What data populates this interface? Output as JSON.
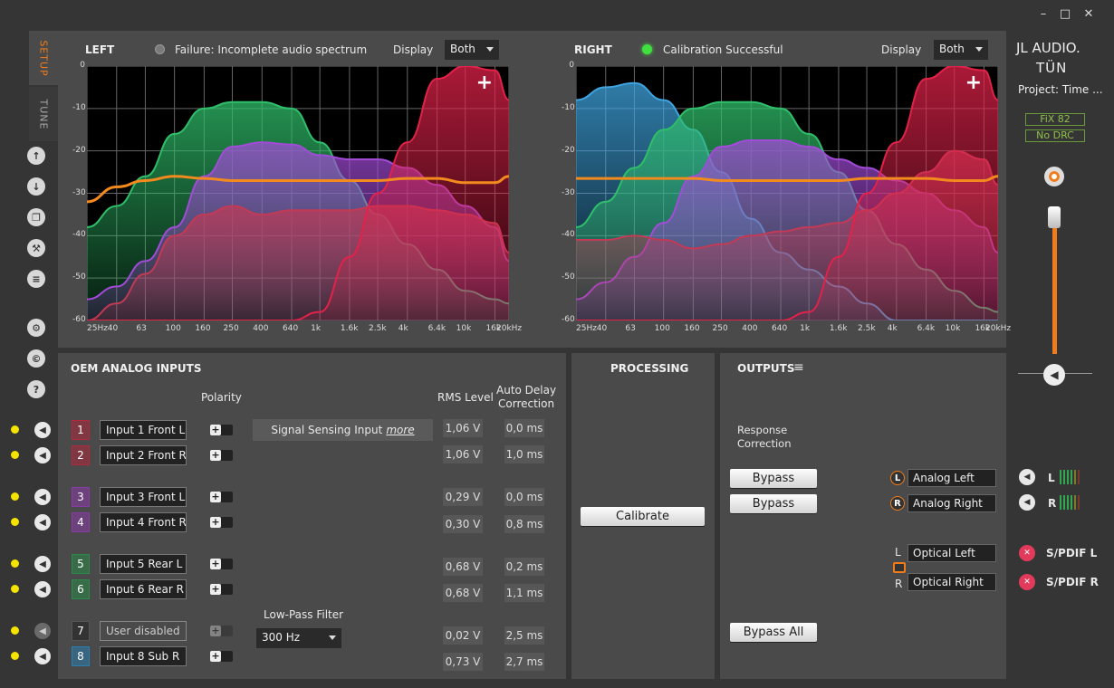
{
  "window": {
    "minimize": "–",
    "maximize": "□",
    "close": "✕"
  },
  "tabs": {
    "setup": "SETUP",
    "tune": "TUNE"
  },
  "brand": {
    "logo_line1": "JL AUDIO.",
    "logo_line2": "TÜN",
    "project": "Project: Time ...",
    "badge1": "FiX 82",
    "badge2": "No DRC"
  },
  "left_chart": {
    "title": "LEFT",
    "status": "Failure: Incomplete audio spectrum",
    "status_color": "#7a7a7a",
    "display_label": "Display",
    "display_value": "Both",
    "plus": "+"
  },
  "right_chart": {
    "title": "RIGHT",
    "status": "Calibration Successful",
    "status_color": "#3fe03f",
    "display_label": "Display",
    "display_value": "Both",
    "plus": "+"
  },
  "chart_data": [
    {
      "type": "area",
      "title": "LEFT",
      "xscale": "log",
      "xlim": [
        25,
        20000
      ],
      "ylim": [
        -60,
        0
      ],
      "x_ticks": [
        "25Hz",
        "40",
        "63",
        "100",
        "160",
        "250",
        "400",
        "640",
        "1k",
        "1.6k",
        "2.5k",
        "4k",
        "6.4k",
        "10k",
        "16k",
        "20kHz"
      ],
      "y_ticks": [
        "0",
        "-10",
        "-20",
        "-30",
        "-40",
        "-50",
        "-60"
      ],
      "series": [
        {
          "color": "#2fbf6a",
          "x": [
            25,
            40,
            63,
            100,
            160,
            250,
            400,
            640,
            1000,
            1600,
            2500,
            4000,
            6400,
            10000,
            16000,
            20000
          ],
          "y": [
            -38,
            -33,
            -26,
            -16,
            -10,
            -8.5,
            -8.5,
            -10,
            -18,
            -27,
            -35,
            -42,
            -48,
            -53,
            -55,
            -56
          ]
        },
        {
          "color": "#a24bd8",
          "x": [
            25,
            40,
            63,
            100,
            160,
            250,
            400,
            640,
            1000,
            1600,
            2500,
            4000,
            6400,
            10000,
            16000,
            20000
          ],
          "y": [
            -55,
            -52,
            -46,
            -38,
            -26,
            -19,
            -18,
            -18.5,
            -21,
            -22,
            -22,
            -24,
            -28,
            -33,
            -38,
            -46
          ]
        },
        {
          "color": "#c23a55",
          "x": [
            25,
            40,
            63,
            100,
            160,
            250,
            400,
            640,
            1000,
            1600,
            2500,
            4000,
            6400,
            10000,
            16000,
            20000
          ],
          "y": [
            -60,
            -56,
            -49,
            -40,
            -35,
            -33,
            -35,
            -34,
            -34,
            -34,
            -33,
            -33,
            -34,
            -35,
            -37,
            -44
          ]
        },
        {
          "color": "#e3224a",
          "x": [
            25,
            40,
            63,
            100,
            160,
            250,
            400,
            640,
            1000,
            1600,
            2500,
            4000,
            6400,
            10000,
            16000,
            20000
          ],
          "y": [
            -60,
            -60,
            -60,
            -60,
            -60,
            -60,
            -60,
            -60,
            -58,
            -45,
            -30,
            -18,
            -3,
            0,
            -1,
            -8
          ]
        },
        {
          "color": "#f28a1e",
          "x": [
            25,
            40,
            63,
            100,
            160,
            250,
            400,
            640,
            1000,
            1600,
            2500,
            4000,
            6400,
            10000,
            16000,
            20000
          ],
          "y": [
            -32,
            -28.5,
            -27,
            -26,
            -26.5,
            -27,
            -27,
            -27,
            -27,
            -27,
            -27,
            -26.5,
            -26.5,
            -27.5,
            -27.5,
            -26
          ]
        }
      ]
    },
    {
      "type": "area",
      "title": "RIGHT",
      "xscale": "log",
      "xlim": [
        25,
        20000
      ],
      "ylim": [
        -60,
        0
      ],
      "x_ticks": [
        "25Hz",
        "40",
        "63",
        "100",
        "160",
        "250",
        "400",
        "640",
        "1k",
        "1.6k",
        "2.5k",
        "4k",
        "6.4k",
        "10k",
        "16k",
        "20kHz"
      ],
      "y_ticks": [
        "0",
        "-10",
        "-20",
        "-30",
        "-40",
        "-50",
        "-60"
      ],
      "series": [
        {
          "color": "#3fa5e0",
          "x": [
            25,
            40,
            63,
            100,
            160,
            250,
            400,
            640,
            1000,
            1600,
            2500,
            4000,
            6400,
            10000,
            16000,
            20000
          ],
          "y": [
            -8,
            -5,
            -4,
            -8,
            -15,
            -25,
            -36,
            -44,
            -48,
            -52,
            -56,
            -60,
            -60,
            -60,
            -60,
            -60
          ]
        },
        {
          "color": "#2fbf6a",
          "x": [
            25,
            40,
            63,
            100,
            160,
            250,
            400,
            640,
            1000,
            1600,
            2500,
            4000,
            6400,
            10000,
            16000,
            20000
          ],
          "y": [
            -38,
            -32,
            -24,
            -15,
            -10,
            -8.5,
            -8.5,
            -10,
            -16,
            -25,
            -34,
            -42,
            -48,
            -53,
            -57,
            -58
          ]
        },
        {
          "color": "#a24bd8",
          "x": [
            25,
            40,
            63,
            100,
            160,
            250,
            400,
            640,
            1000,
            1600,
            2500,
            4000,
            6400,
            10000,
            16000,
            20000
          ],
          "y": [
            -55,
            -51,
            -45,
            -37,
            -26,
            -19,
            -17.5,
            -17.5,
            -19,
            -22,
            -24,
            -27,
            -30,
            -34,
            -38,
            -44
          ]
        },
        {
          "color": "#c23a55",
          "x": [
            25,
            40,
            63,
            100,
            160,
            250,
            400,
            640,
            1000,
            1600,
            2500,
            4000,
            6400,
            10000,
            16000,
            20000
          ],
          "y": [
            -41,
            -41,
            -40,
            -41,
            -43,
            -42,
            -40,
            -39,
            -38,
            -37,
            -34,
            -30,
            -25,
            -20,
            -22,
            -28
          ]
        },
        {
          "color": "#e3224a",
          "x": [
            25,
            40,
            63,
            100,
            160,
            250,
            400,
            640,
            1000,
            1600,
            2500,
            4000,
            6400,
            10000,
            16000,
            20000
          ],
          "y": [
            -60,
            -60,
            -60,
            -60,
            -60,
            -60,
            -60,
            -60,
            -58,
            -45,
            -30,
            -18,
            -3,
            0,
            -1,
            -8
          ]
        },
        {
          "color": "#f28a1e",
          "x": [
            25,
            40,
            63,
            100,
            160,
            250,
            400,
            640,
            1000,
            1600,
            2500,
            4000,
            6400,
            10000,
            16000,
            20000
          ],
          "y": [
            -26.5,
            -26.5,
            -26.5,
            -26.5,
            -26.5,
            -27,
            -27,
            -27,
            -27,
            -27,
            -26.5,
            -26.5,
            -26.5,
            -27,
            -27,
            -26
          ]
        }
      ]
    }
  ],
  "oem": {
    "title": "OEM ANALOG INPUTS",
    "polarity": "Polarity",
    "rms": "RMS Level",
    "auto_delay_1": "Auto Delay",
    "auto_delay_2": "Correction",
    "signal_sensing": "Signal Sensing Input",
    "signal_more": "more",
    "lpf_label": "Low-Pass Filter",
    "lpf_value": "300 Hz",
    "inputs": [
      {
        "n": "1",
        "name": "Input 1 Front L",
        "rms": "1,06 V",
        "delay": "0,0 ms",
        "color": "#b3283c"
      },
      {
        "n": "2",
        "name": "Input 2 Front R",
        "rms": "1,06 V",
        "delay": "1,0 ms",
        "color": "#b3283c"
      },
      {
        "n": "3",
        "name": "Input 3 Front L",
        "rms": "0,29 V",
        "delay": "0,0 ms",
        "color": "#8a3aa8"
      },
      {
        "n": "4",
        "name": "Input 4 Front R",
        "rms": "0,30 V",
        "delay": "0,8 ms",
        "color": "#8a3aa8"
      },
      {
        "n": "5",
        "name": "Input 5 Rear L",
        "rms": "0,68 V",
        "delay": "0,2 ms",
        "color": "#2a8a4a"
      },
      {
        "n": "6",
        "name": "Input 6 Rear R",
        "rms": "0,68 V",
        "delay": "1,1 ms",
        "color": "#2a8a4a"
      },
      {
        "n": "7",
        "name": "User disabled",
        "rms": "0,02 V",
        "delay": "2,5 ms",
        "color": "#555555"
      },
      {
        "n": "8",
        "name": "Input 8 Sub R",
        "rms": "0,73 V",
        "delay": "2,7 ms",
        "color": "#2a7fb0"
      }
    ]
  },
  "processing": {
    "title": "PROCESSING",
    "calibrate": "Calibrate"
  },
  "outputs": {
    "title": "OUTPUTS",
    "response_1": "Response",
    "response_2": "Correction",
    "bypass": "Bypass",
    "bypass_all": "Bypass All",
    "analog_left": "Analog Left",
    "analog_right": "Analog Right",
    "optical_left": "Optical Left",
    "optical_right": "Optical Right",
    "L": "L",
    "R": "R",
    "spdif_l": "S/PDIF L",
    "spdif_r": "S/PDIF R"
  }
}
